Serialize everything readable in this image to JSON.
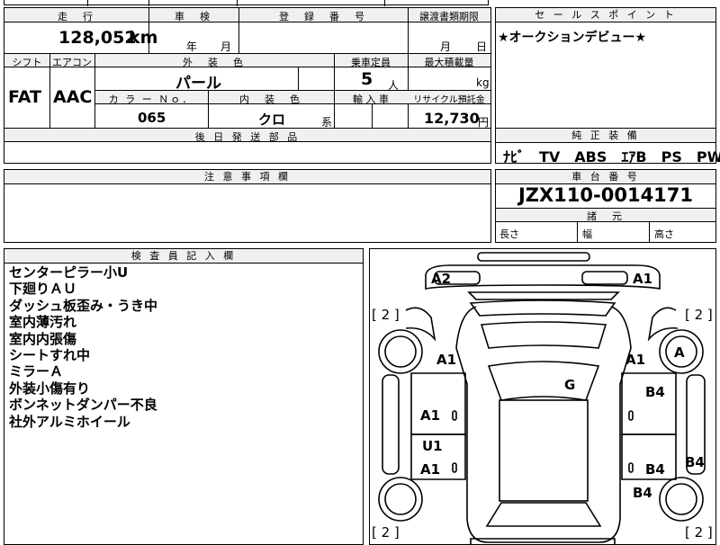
{
  "top": {
    "distance_label": "走　行",
    "distance_value": "128,052",
    "distance_unit": "km",
    "shaken_label": "車　検",
    "shaken_year": "年",
    "shaken_month": "月",
    "reg_label": "登　録　番　号",
    "transfer_label": "譲渡書類期限",
    "transfer_month": "月",
    "transfer_day": "日",
    "sales_label": "セ ー ル ス ポ イ ン ト",
    "sales_text": "★オークションデビュー★"
  },
  "row2": {
    "shift_label": "シフト",
    "shift_value": "FAT",
    "ac_label": "エアコン",
    "ac_value": "AAC",
    "ext_color_label": "外　装　色",
    "ext_color_value": "パール",
    "capacity_label": "乗車定員",
    "capacity_value": "5",
    "capacity_unit": "人",
    "max_load_label": "最大積載量",
    "max_load_unit": "kg",
    "color_no_label": "カ ラ ー Ｎｏ．",
    "color_no_value": "065",
    "int_color_label": "内　装　色",
    "int_color_value": "クロ",
    "int_color_unit": "系",
    "import_label": "輸 入 車",
    "recycle_label": "リサイクル預託金",
    "recycle_value": "12,730",
    "recycle_unit": "円"
  },
  "later_parts_label": "後 日 発 送 部 品",
  "equipment": {
    "label": "純 正 装 備",
    "value": "ﾅﾋﾞ　TV　ABS　ｴｱB　PS　PW"
  },
  "notice_label": "注 意 事 項 欄",
  "chassis": {
    "label": "車 台 番 号",
    "value": "JZX110-0014171"
  },
  "specs": {
    "label": "諸　元",
    "length_label": "長さ",
    "width_label": "幅",
    "height_label": "高さ"
  },
  "inspector": {
    "label": "検 査 員 記 入 欄",
    "notes": [
      "センターピラー小U",
      "下廻りＡＵ",
      "ダッシュ板歪み・うき中",
      "室内薄汚れ",
      "室内内張傷",
      "シートすれ中",
      "ミラーＡ",
      "外装小傷有り",
      "ボンネットダンパー不良",
      "社外アルミホイール"
    ]
  },
  "diagram": {
    "marks": {
      "a2_top_left": "A2",
      "a1_top_right": "A1",
      "a1_front_left": "A1",
      "a1_front_right": "A1",
      "a_wheel_front_right": "A",
      "g_windshield": "G",
      "a1_left_door_front": "A1",
      "b4_right_door_front": "B4",
      "u1_left_door_rear": "U1",
      "a1_left_door_rear": "A1",
      "b4_right_door_rear": "B4",
      "b4_right_side": "B4",
      "b4_rear_right": "B4"
    },
    "tire_counts": {
      "front_left": "[ 2 ]",
      "front_right": "[ 2 ]",
      "rear_left": "[ 2 ]",
      "rear_right": "[ 2 ]"
    }
  }
}
